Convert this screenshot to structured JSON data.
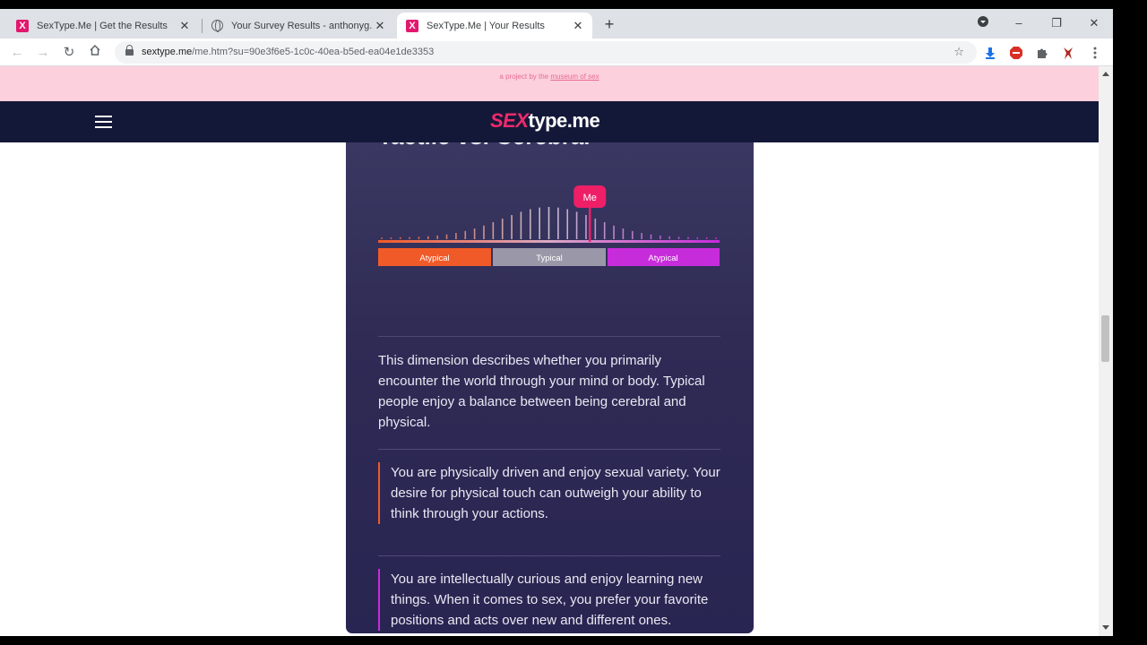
{
  "browser": {
    "tabs": [
      {
        "title": "SexType.Me | Get the Results",
        "icon": "x-favicon",
        "active": false
      },
      {
        "title": "Your Survey Results - anthonyg...",
        "icon": "globe-icon",
        "active": false
      },
      {
        "title": "SexType.Me | Your Results",
        "icon": "x-favicon",
        "active": true
      }
    ],
    "url_host": "sextype.me",
    "url_rest": "/me.htm?su=90e3f6e5-1c0c-40ea-b5ed-ea04e1de3353"
  },
  "page": {
    "banner": {
      "prefix": "a project by the",
      "link": "museum of sex"
    },
    "logo": {
      "part1": "SEX",
      "part2": "type.me"
    },
    "card": {
      "title": "Tactile vs. Cerebral",
      "chart": {
        "marker_label": "Me",
        "segments": [
          "Atypical",
          "Typical",
          "Atypical"
        ],
        "colors": {
          "left": "#f05a28",
          "middle": "#9a98a8",
          "right": "#c72cdb",
          "marker": "#ee1f67"
        },
        "marker_position": 0.62
      },
      "description": "This dimension describes whether you primarily encounter the world through your mind or body. Typical people enjoy a balance between being cerebral and physical.",
      "trait_tactile": "You are physically driven and enjoy sexual variety. Your desire for physical touch can outweigh your ability to think through your actions.",
      "trait_cerebral": "You are intellectually curious and enjoy learning new things. When it comes to sex, you prefer your favorite positions and acts over new and different ones."
    }
  }
}
